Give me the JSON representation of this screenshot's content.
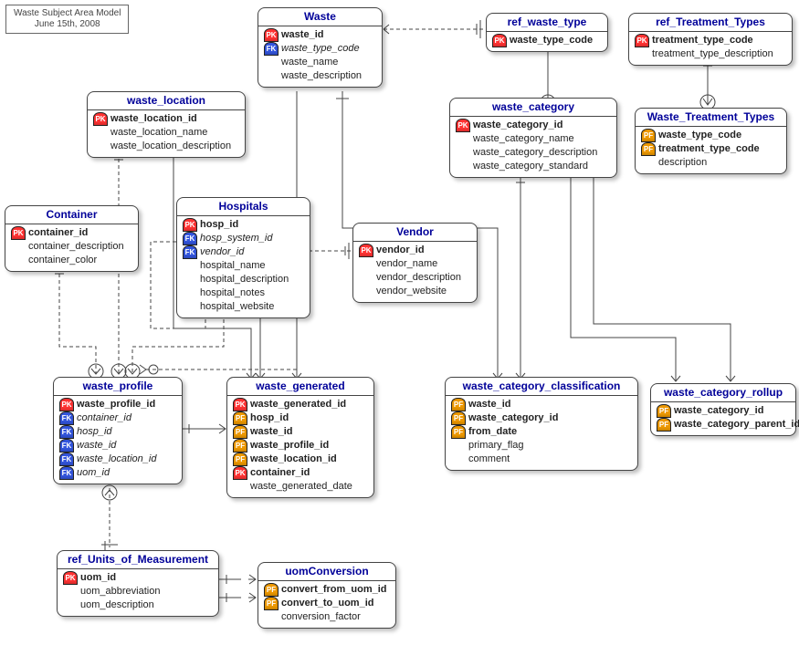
{
  "title": {
    "line1": "Waste Subject Area Model",
    "line2": "June 15th, 2008"
  },
  "entities": {
    "waste": {
      "name": "Waste",
      "fields": [
        {
          "key": "pk",
          "label": "waste_id"
        },
        {
          "key": "fk",
          "label": "waste_type_code",
          "style": "fk-italic"
        },
        {
          "key": "none",
          "label": "waste_name",
          "style": "plain"
        },
        {
          "key": "none",
          "label": "waste_description",
          "style": "plain"
        }
      ]
    },
    "ref_waste_type": {
      "name": "ref_waste_type",
      "fields": [
        {
          "key": "pk",
          "label": "waste_type_code"
        }
      ]
    },
    "ref_treatment_types": {
      "name": "ref_Treatment_Types",
      "fields": [
        {
          "key": "pk",
          "label": "treatment_type_code"
        },
        {
          "key": "none",
          "label": "treatment_type_description",
          "style": "plain"
        }
      ]
    },
    "waste_location": {
      "name": "waste_location",
      "fields": [
        {
          "key": "pk",
          "label": "waste_location_id"
        },
        {
          "key": "none",
          "label": "waste_location_name",
          "style": "plain"
        },
        {
          "key": "none",
          "label": "waste_location_description",
          "style": "plain"
        }
      ]
    },
    "waste_category": {
      "name": "waste_category",
      "fields": [
        {
          "key": "pk",
          "label": "waste_category_id"
        },
        {
          "key": "none",
          "label": "waste_category_name",
          "style": "plain"
        },
        {
          "key": "none",
          "label": "waste_category_description",
          "style": "plain"
        },
        {
          "key": "none",
          "label": "waste_category_standard",
          "style": "plain"
        }
      ]
    },
    "waste_treatment_types": {
      "name": "Waste_Treatment_Types",
      "fields": [
        {
          "key": "pf",
          "label": "waste_type_code"
        },
        {
          "key": "pf",
          "label": "treatment_type_code"
        },
        {
          "key": "none",
          "label": "description",
          "style": "plain"
        }
      ]
    },
    "container": {
      "name": "Container",
      "fields": [
        {
          "key": "pk",
          "label": "container_id"
        },
        {
          "key": "none",
          "label": "container_description",
          "style": "plain"
        },
        {
          "key": "none",
          "label": "container_color",
          "style": "plain"
        }
      ]
    },
    "hospitals": {
      "name": "Hospitals",
      "fields": [
        {
          "key": "pk",
          "label": "hosp_id"
        },
        {
          "key": "fk",
          "label": "hosp_system_id",
          "style": "fk-italic"
        },
        {
          "key": "fk",
          "label": "vendor_id",
          "style": "fk-italic"
        },
        {
          "key": "none",
          "label": "hospital_name",
          "style": "plain"
        },
        {
          "key": "none",
          "label": "hospital_description",
          "style": "plain"
        },
        {
          "key": "none",
          "label": "hospital_notes",
          "style": "plain"
        },
        {
          "key": "none",
          "label": "hospital_website",
          "style": "plain"
        }
      ]
    },
    "vendor": {
      "name": "Vendor",
      "fields": [
        {
          "key": "pk",
          "label": "vendor_id"
        },
        {
          "key": "none",
          "label": "vendor_name",
          "style": "plain"
        },
        {
          "key": "none",
          "label": "vendor_description",
          "style": "plain"
        },
        {
          "key": "none",
          "label": "vendor_website",
          "style": "plain"
        }
      ]
    },
    "waste_profile": {
      "name": "waste_profile",
      "fields": [
        {
          "key": "pk",
          "label": "waste_profile_id"
        },
        {
          "key": "fk",
          "label": "container_id",
          "style": "fk-italic"
        },
        {
          "key": "fk",
          "label": "hosp_id",
          "style": "fk-italic"
        },
        {
          "key": "fk",
          "label": "waste_id",
          "style": "fk-italic"
        },
        {
          "key": "fk",
          "label": "waste_location_id",
          "style": "fk-italic"
        },
        {
          "key": "fk",
          "label": "uom_id",
          "style": "fk-italic"
        }
      ]
    },
    "waste_generated": {
      "name": "waste_generated",
      "fields": [
        {
          "key": "pk",
          "label": "waste_generated_id"
        },
        {
          "key": "pf",
          "label": "hosp_id"
        },
        {
          "key": "pf",
          "label": "waste_id"
        },
        {
          "key": "pf",
          "label": "waste_profile_id"
        },
        {
          "key": "pf",
          "label": "waste_location_id"
        },
        {
          "key": "pk",
          "label": "container_id"
        },
        {
          "key": "none",
          "label": "waste_generated_date",
          "style": "plain"
        }
      ]
    },
    "waste_category_classification": {
      "name": "waste_category_classification",
      "fields": [
        {
          "key": "pf",
          "label": "waste_id"
        },
        {
          "key": "pf",
          "label": "waste_category_id"
        },
        {
          "key": "pf",
          "label": "from_date"
        },
        {
          "key": "none",
          "label": "primary_flag",
          "style": "plain"
        },
        {
          "key": "none",
          "label": "comment",
          "style": "plain"
        }
      ]
    },
    "waste_category_rollup": {
      "name": "waste_category_rollup",
      "fields": [
        {
          "key": "pf",
          "label": "waste_category_id"
        },
        {
          "key": "pf",
          "label": "waste_category_parent_id"
        }
      ]
    },
    "ref_uom": {
      "name": "ref_Units_of_Measurement",
      "fields": [
        {
          "key": "pk",
          "label": "uom_id"
        },
        {
          "key": "none",
          "label": "uom_abbreviation",
          "style": "plain"
        },
        {
          "key": "none",
          "label": "uom_description",
          "style": "plain"
        }
      ]
    },
    "uom_conversion": {
      "name": "uomConversion",
      "fields": [
        {
          "key": "pf",
          "label": "convert_from_uom_id"
        },
        {
          "key": "pf",
          "label": "convert_to_uom_id"
        },
        {
          "key": "none",
          "label": "conversion_factor",
          "style": "plain"
        }
      ]
    }
  }
}
